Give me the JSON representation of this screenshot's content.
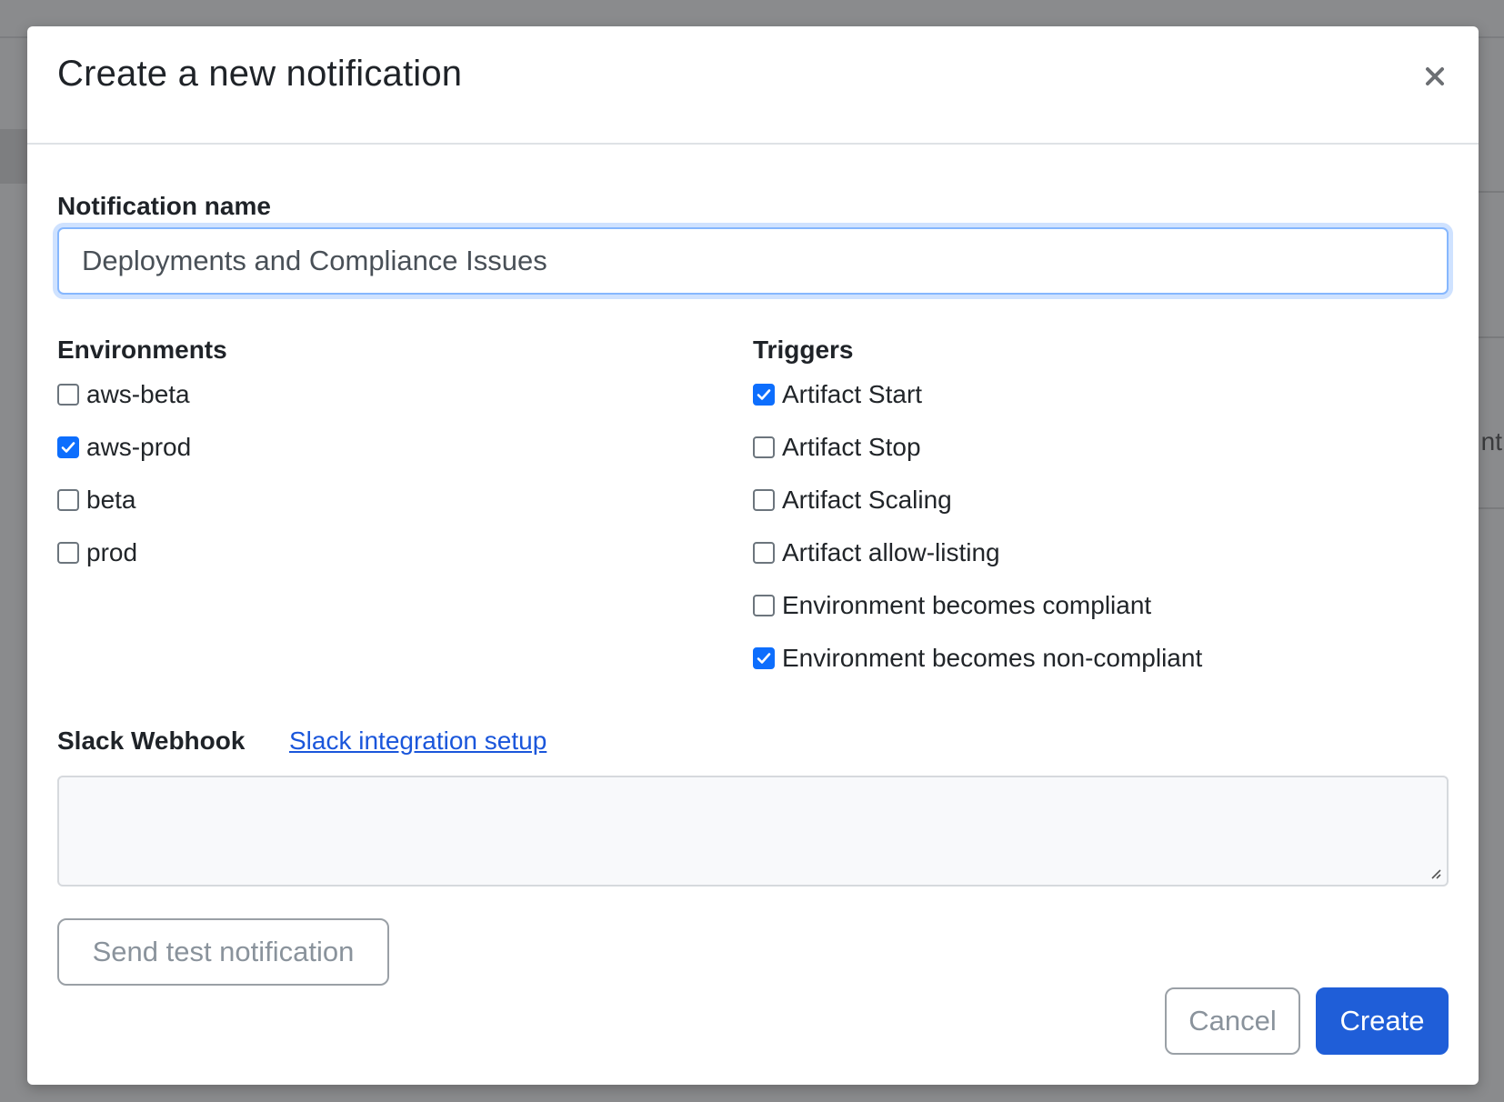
{
  "modal": {
    "title": "Create a new notification",
    "close_icon": "close-icon"
  },
  "name_field": {
    "label": "Notification name",
    "value": "Deployments and Compliance Issues"
  },
  "environments": {
    "heading": "Environments",
    "items": [
      {
        "label": "aws-beta",
        "checked": false
      },
      {
        "label": "aws-prod",
        "checked": true
      },
      {
        "label": "beta",
        "checked": false
      },
      {
        "label": "prod",
        "checked": false
      }
    ]
  },
  "triggers": {
    "heading": "Triggers",
    "items": [
      {
        "label": "Artifact Start",
        "checked": true
      },
      {
        "label": "Artifact Stop",
        "checked": false
      },
      {
        "label": "Artifact Scaling",
        "checked": false
      },
      {
        "label": "Artifact allow-listing",
        "checked": false
      },
      {
        "label": "Environment becomes compliant",
        "checked": false
      },
      {
        "label": "Environment becomes non-compliant",
        "checked": true
      }
    ]
  },
  "slack": {
    "label": "Slack Webhook",
    "link_text": "Slack integration setup",
    "value": ""
  },
  "buttons": {
    "test": "Send test notification",
    "cancel": "Cancel",
    "create": "Create"
  },
  "background": {
    "partial_text": "nt"
  },
  "colors": {
    "primary": "#1f5ed8",
    "checkbox_checked": "#0d6efd",
    "link": "#1a56db",
    "focus_ring": "#cfe2ff"
  }
}
